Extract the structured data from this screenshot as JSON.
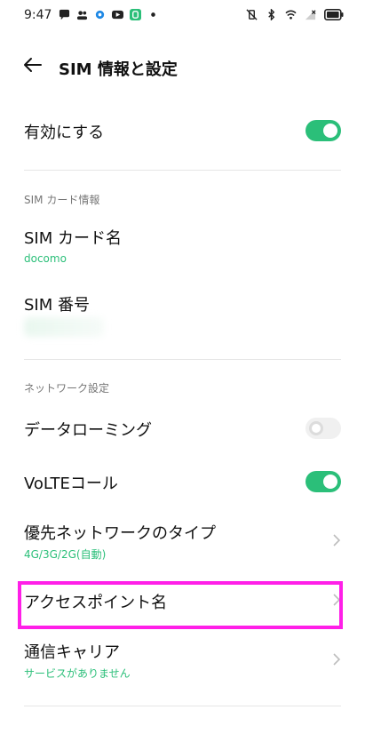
{
  "status": {
    "time": "9:47",
    "left_icons": [
      "chat-icon",
      "people-icon",
      "settings-gear-icon",
      "youtube-icon",
      "app-icon",
      "dot-icon"
    ],
    "right_icons": [
      "vibrate-mute-icon",
      "bluetooth-icon",
      "wifi-icon",
      "signal-icon",
      "battery-icon"
    ]
  },
  "header": {
    "title": "SIM 情報と設定"
  },
  "rows": {
    "enable": {
      "label": "有効にする",
      "on": true
    },
    "sim_card_section": "SIM カード情報",
    "sim_card_name": {
      "label": "SIM カード名",
      "value": "docomo"
    },
    "sim_number": {
      "label": "SIM 番号"
    },
    "network_section": "ネットワーク設定",
    "data_roaming": {
      "label": "データローミング",
      "on": false
    },
    "volte": {
      "label": "VoLTEコール",
      "on": true
    },
    "preferred_network": {
      "label": "優先ネットワークのタイプ",
      "value": "4G/3G/2G(自動)"
    },
    "apn": {
      "label": "アクセスポイント名"
    },
    "carrier": {
      "label": "通信キャリア",
      "value": "サービスがありません"
    }
  },
  "colors": {
    "accent": "#2bbf79",
    "highlight": "#ff1fe8"
  }
}
